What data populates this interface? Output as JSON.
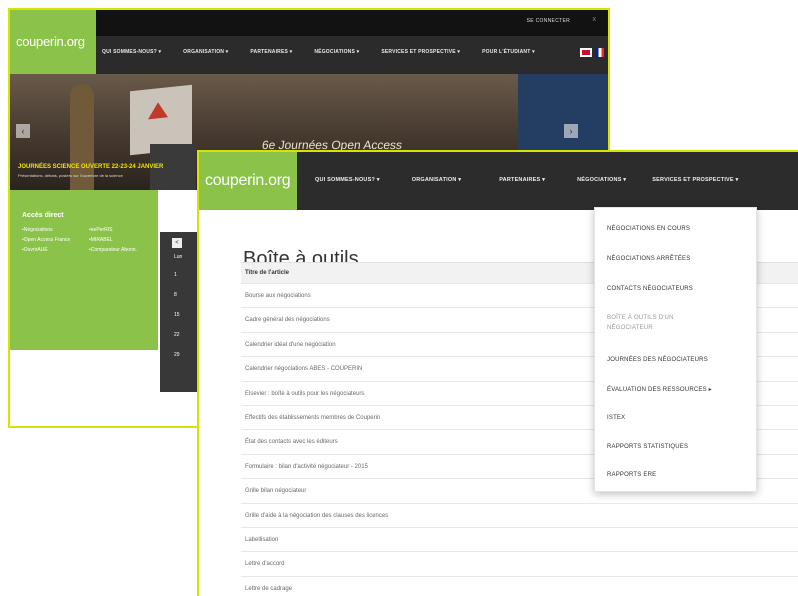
{
  "back_window": {
    "login": "SE CONNECTER",
    "close_glyph": "x",
    "logo": "couperin.org",
    "menu": [
      "QUI SOMMES-NOUS? ▾",
      "ORGANISATION ▾",
      "PARTENAIRES ▾",
      "NÉGOCIATIONS ▾",
      "SERVICES ET PROSPECTIVE ▾",
      "POUR L'ÉTUDIANT ▾"
    ],
    "banner_sign": "6e Journées Open Access",
    "banner_caption": "JOURNÉES SCIENCE OUVERTE 22-23-24 JANVIER",
    "banner_subcaption": "Présentations, débats, posters sur l'ouverture de la science",
    "prev_glyph": "‹",
    "next_glyph": "›",
    "quick_access_title": "Accès direct",
    "quick_access_items": [
      "Négociations",
      "eePerRIS",
      "Open Access France",
      "MIRABEL",
      "OuvrirAUE",
      "Comparateur Abonn."
    ],
    "calendar_prev": "<",
    "calendar_days": [
      "Lun",
      "1",
      "8",
      "15",
      "22",
      "29"
    ]
  },
  "front_window": {
    "logo": "couperin.org",
    "menu": [
      "QUI SOMMES-NOUS? ▾",
      "ORGANISATION ▾",
      "PARTENAIRES ▾",
      "NÉGOCIATIONS ▾",
      "SERVICES ET PROSPECTIVE ▾"
    ],
    "page_title": "Boîte à outils",
    "table_header": "Titre de l'article",
    "rows": [
      "Bourse aux négociations",
      "Cadre général des négociations",
      "Calendrier idéal d'une négociation",
      "Calendrier négociations ABES - COUPERIN",
      "Elsevier : boîte à outils pour les négociateurs",
      "Effectifs des établissements membres de Couperin",
      "État des contacts avec les éditeurs",
      "Formulaire : bilan d'activité négociateur - 2015",
      "Grille bilan négociateur",
      "Grille d'aide à la négociation des clauses des licences",
      "Labellisation",
      "Lettre d'accord",
      "Lettre de cadrage"
    ],
    "dropdown": {
      "items": [
        "NÉGOCIATIONS EN COURS",
        "NÉGOCIATIONS ARRÊTÉES",
        "CONTACTS NÉGOCIATEURS",
        "BOÎTE À OUTILS D'UN",
        "JOURNÉES DES NÉGOCIATEURS",
        "ÉVALUATION DES RESSOURCES ▸",
        "ISTEX",
        "RAPPORTS STATISTIQUES",
        "RAPPORTS ERE"
      ],
      "active_sub": "NÉGOCIATEUR"
    }
  }
}
